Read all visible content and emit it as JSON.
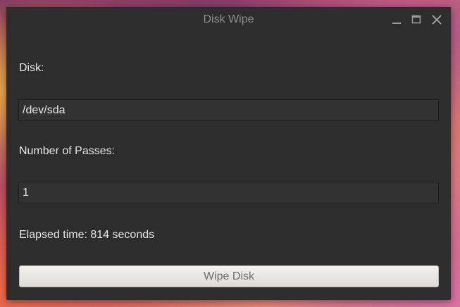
{
  "window": {
    "title": "Disk Wipe",
    "controls": {
      "minimize": "minimize-icon",
      "maximize": "maximize-icon",
      "close": "close-icon"
    }
  },
  "form": {
    "disk_label": "Disk:",
    "disk_value": "/dev/sda",
    "passes_label": "Number of Passes:",
    "passes_value": "1",
    "elapsed_text": "Elapsed time: 814 seconds",
    "wipe_button_label": "Wipe Disk"
  },
  "colors": {
    "window_bg": "#2d2d2d",
    "field_bg": "#323232",
    "text": "#e6e6e6",
    "title_text": "#8e8e8e",
    "button_bg": "#ebe9e6"
  }
}
